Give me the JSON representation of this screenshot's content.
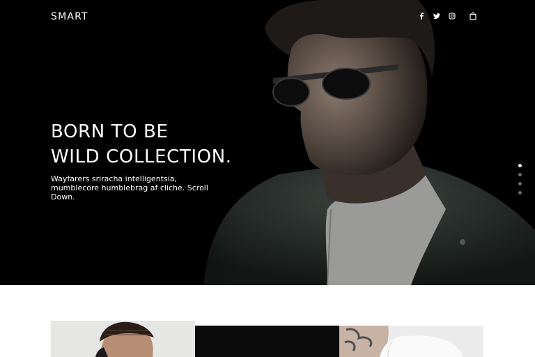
{
  "header": {
    "brand": "SMART",
    "icons": [
      "facebook-icon",
      "twitter-icon",
      "instagram-icon",
      "shopping-bag-icon"
    ]
  },
  "hero": {
    "title_line1": "BORN TO BE",
    "title_line2": "WILD COLLECTION.",
    "subtitle": "Wayfarers sriracha intelligentsia, mumblecore humblebrag af cliche. Scroll Down.",
    "slider": {
      "total": 4,
      "active": 1
    }
  },
  "products": [
    {
      "image": "man-with-braided-hair-photo"
    },
    {
      "image": "black-garment-photo"
    },
    {
      "image": "tattooed-man-white-tee-photo"
    }
  ],
  "colors": {
    "hero_bg": "#000000",
    "text": "#ffffff",
    "dot_inactive": "#6b6b6b",
    "page_bg": "#ffffff"
  }
}
